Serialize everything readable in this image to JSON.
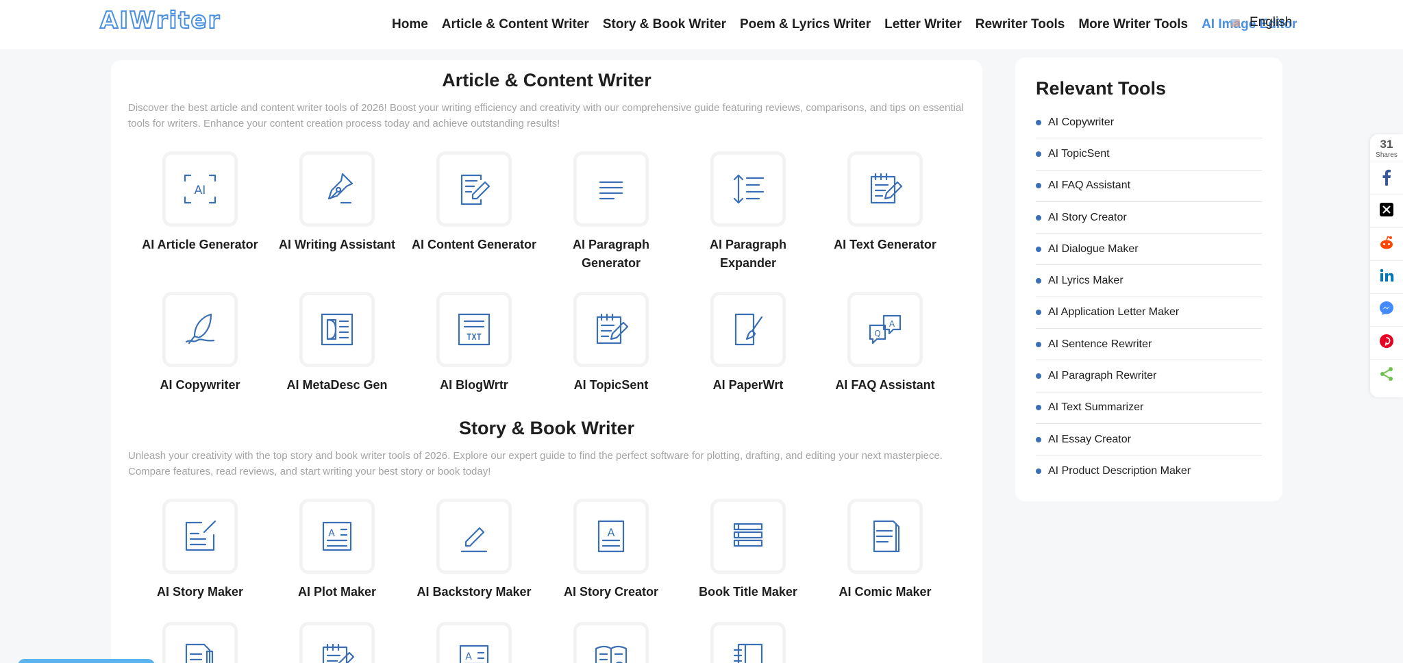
{
  "header": {
    "logo": "AIWriter",
    "nav": [
      {
        "label": "Home",
        "accent": false
      },
      {
        "label": "Article & Content Writer",
        "accent": false
      },
      {
        "label": "Story & Book Writer",
        "accent": false
      },
      {
        "label": "Poem & Lyrics Writer",
        "accent": false
      },
      {
        "label": "Letter Writer",
        "accent": false
      },
      {
        "label": "Rewriter Tools",
        "accent": false
      },
      {
        "label": "More Writer Tools",
        "accent": false
      },
      {
        "label": "AI Image Editor",
        "accent": true
      }
    ],
    "language": "English"
  },
  "sections": [
    {
      "title": "Article & Content Writer",
      "description": "Discover the best article and content writer tools of 2026! Boost your writing efficiency and creativity with our comprehensive guide featuring reviews, comparisons, and tips on essential tools for writers. Enhance your content creation process today and achieve outstanding results!",
      "tools": [
        {
          "name": "AI Article Generator",
          "icon": "ai-scan-icon"
        },
        {
          "name": "AI Writing Assistant",
          "icon": "fountain-pen-icon"
        },
        {
          "name": "AI Content Generator",
          "icon": "document-edit-icon"
        },
        {
          "name": "AI Paragraph Generator",
          "icon": "paragraph-lines-icon"
        },
        {
          "name": "AI Paragraph Expander",
          "icon": "line-spacing-icon"
        },
        {
          "name": "AI Text Generator",
          "icon": "notepad-pen-icon"
        },
        {
          "name": "AI Copywriter",
          "icon": "feather-signature-icon"
        },
        {
          "name": "AI MetaDesc Gen",
          "icon": "meta-description-icon"
        },
        {
          "name": "AI BlogWrtr",
          "icon": "txt-file-icon"
        },
        {
          "name": "AI TopicSent",
          "icon": "notepad-pen-icon"
        },
        {
          "name": "AI PaperWrt",
          "icon": "paper-brush-icon"
        },
        {
          "name": "AI FAQ Assistant",
          "icon": "qa-bubbles-icon"
        }
      ]
    },
    {
      "title": "Story & Book Writer",
      "description": "Unleash your creativity with the top story and book writer tools of 2026. Explore our expert guide to find the perfect software for plotting, drafting, and editing your next masterpiece. Compare features, read reviews, and start writing your best story or book today!",
      "tools": [
        {
          "name": "AI Story Maker",
          "icon": "compose-icon"
        },
        {
          "name": "AI Plot Maker",
          "icon": "text-block-icon"
        },
        {
          "name": "AI Backstory Maker",
          "icon": "pen-underline-icon"
        },
        {
          "name": "AI Story Creator",
          "icon": "page-a-icon"
        },
        {
          "name": "Book Title Maker",
          "icon": "book-stack-icon"
        },
        {
          "name": "AI Comic Maker",
          "icon": "pages-icon"
        },
        {
          "name": "",
          "icon": "doc-pen-icon"
        },
        {
          "name": "",
          "icon": "notepad-pen-icon"
        },
        {
          "name": "",
          "icon": "text-block-icon"
        },
        {
          "name": "",
          "icon": "open-book-icon"
        },
        {
          "name": "",
          "icon": "notebook-icon"
        }
      ]
    }
  ],
  "sidebar": {
    "title": "Relevant Tools",
    "items": [
      "AI Copywriter",
      "AI TopicSent",
      "AI FAQ Assistant",
      "AI Story Creator",
      "AI Dialogue Maker",
      "AI Lyrics Maker",
      "AI Application Letter Maker",
      "AI Sentence Rewriter",
      "AI Paragraph Rewriter",
      "AI Text Summarizer",
      "AI Essay Creator",
      "AI Product Description Maker"
    ]
  },
  "share": {
    "count": "31",
    "label": "Shares",
    "buttons": [
      {
        "network": "facebook",
        "icon": "facebook-icon",
        "color": "#3b5998"
      },
      {
        "network": "x",
        "icon": "x-icon",
        "color": "#000000"
      },
      {
        "network": "reddit",
        "icon": "reddit-icon",
        "color": "#ff4500"
      },
      {
        "network": "linkedin",
        "icon": "linkedin-icon",
        "color": "#0077b5"
      },
      {
        "network": "messenger",
        "icon": "messenger-icon",
        "color": "#448aff"
      },
      {
        "network": "pinterest",
        "icon": "pinterest-icon",
        "color": "#e60023"
      },
      {
        "network": "share",
        "icon": "share-icon",
        "color": "#6ec24a"
      }
    ]
  },
  "colors": {
    "accent": "#4a8fe0",
    "icon": "#3a6fb5",
    "muted_text": "#a4a4a4"
  }
}
